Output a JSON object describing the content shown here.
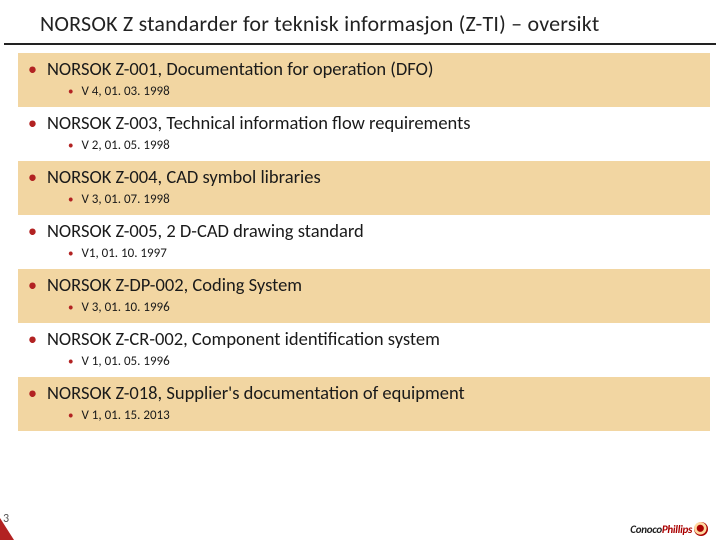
{
  "title": "NORSOK Z standarder for teknisk informasjon (Z-TI) – oversikt",
  "items": [
    {
      "title": "NORSOK Z-001, Documentation for operation (DFO)",
      "sub": "V 4, 01. 03. 1998",
      "highlight": true
    },
    {
      "title": "NORSOK Z-003, Technical information flow requirements",
      "sub": "V 2, 01. 05. 1998",
      "highlight": false
    },
    {
      "title": "NORSOK Z-004, CAD symbol libraries",
      "sub": "V 3, 01. 07. 1998",
      "highlight": true
    },
    {
      "title": "NORSOK Z-005, 2 D-CAD drawing standard",
      "sub": "V1, 01. 10. 1997",
      "highlight": false
    },
    {
      "title": "NORSOK Z-DP-002, Coding System",
      "sub": "V 3, 01. 10. 1996",
      "highlight": true
    },
    {
      "title": "NORSOK Z-CR-002, Component identification system",
      "sub": "V 1, 01. 05. 1996",
      "highlight": false
    },
    {
      "title": "NORSOK Z-018, Supplier's documentation of equipment",
      "sub": "V 1, 01. 15. 2013",
      "highlight": true
    }
  ],
  "page_number": "3",
  "logo": {
    "part1": "Conoco",
    "part2": "Phillips"
  }
}
